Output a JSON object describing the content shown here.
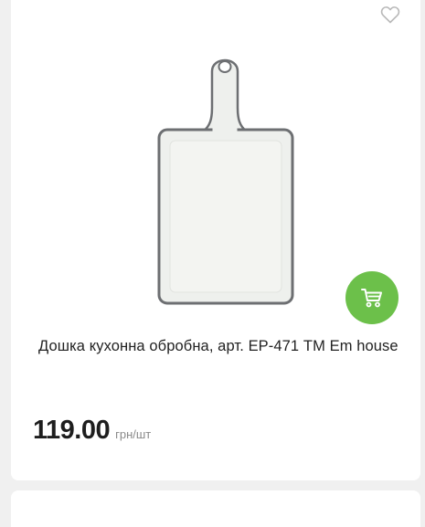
{
  "product": {
    "title": "Дошка кухонна обробна, арт. ЕР-471 ТМ Em house",
    "price": "119.00",
    "unit": "грн/шт"
  },
  "icons": {
    "favorite": "heart-outline-icon",
    "cart": "shopping-cart-icon"
  },
  "colors": {
    "cart_button": "#6cc04a",
    "card_background": "#ffffff",
    "page_background": "#f0f0f0",
    "price_text": "#1e1e1e",
    "unit_text": "#8a8a8a"
  }
}
